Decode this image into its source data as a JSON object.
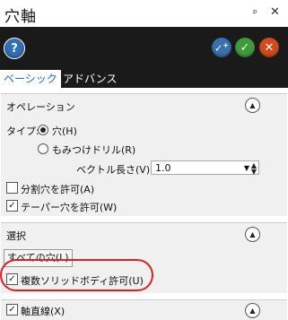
{
  "panel": {
    "title": "穴軸",
    "pin_icon": "pin-icon",
    "close_icon": "close-icon"
  },
  "toolbar": {
    "help": "?",
    "ok_plus": "+",
    "ok": "✓",
    "cancel": "✕"
  },
  "tabs": [
    {
      "label": "ベーシック"
    },
    {
      "label": "アドバンス"
    }
  ],
  "operation": {
    "header": "オペレーション",
    "type_label": "タイプ:",
    "hole_label": "穴(H)",
    "tap_drill_label": "もみつけドリル(R)",
    "vector_length_label": "ベクトル長さ(V):",
    "vector_length_value": "1.0",
    "split_hole_label": "分割穴を許可(A)",
    "taper_hole_label": "テーパー穴を許可(W)"
  },
  "selection": {
    "header": "選択",
    "all_holes_label": "すべての穴(L)",
    "multi_solid_label": "複数ソリッドボディ許可(U)"
  },
  "axis_line": {
    "label": "軸直線(X)"
  }
}
